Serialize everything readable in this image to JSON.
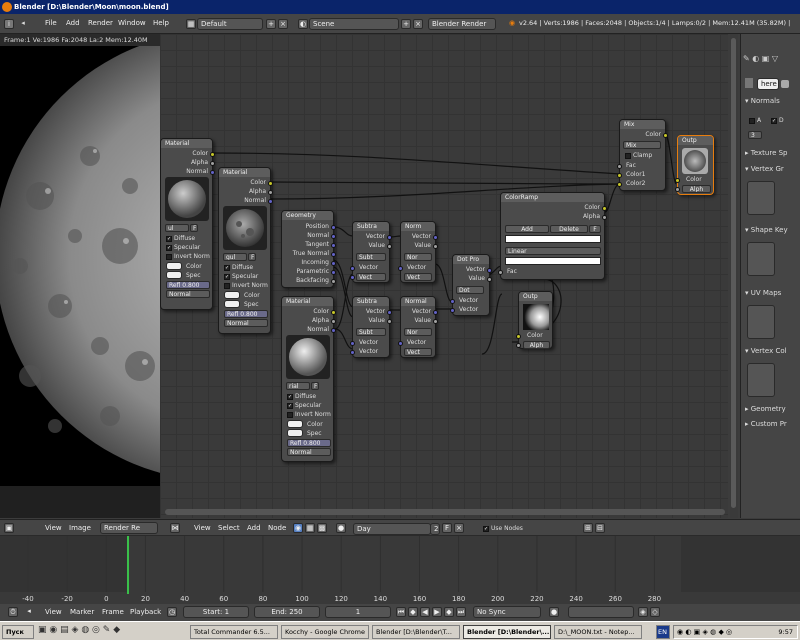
{
  "window_title": "Blender [D:\\Blender\\Moon\\moon.blend]",
  "menu": {
    "items": [
      "File",
      "Add",
      "Render",
      "Window",
      "Help"
    ]
  },
  "screen_layout": "Default",
  "scene_name": "Scene",
  "render_engine": "Blender Render",
  "stats": "v2.64 | Verts:1986 | Faces:2048 | Objects:1/4 | Lamps:0/2 | Mem:12.41M (35.82M) |",
  "image_view": {
    "info": "Frame:1 Ve:1986 Fa:2048 La:2 Mem:12.40M",
    "header": [
      "View",
      "Image",
      "Render Re"
    ]
  },
  "node_editor": {
    "header": [
      "View",
      "Select",
      "Add",
      "Node"
    ],
    "material_name": "Day",
    "users": "2",
    "fake_label": "F",
    "use_nodes": "Use Nodes",
    "nodes": {
      "mat1": {
        "title": "Material",
        "outputs": [
          "Color",
          "Alpha",
          "Normal"
        ],
        "mat_label": "ul",
        "f": "F",
        "checks": [
          "Diffuse",
          "Specular",
          "Invert Norm"
        ],
        "inputs": [
          "Color",
          "Spec"
        ],
        "refl": "Refl 0.800",
        "normal": "Normal"
      },
      "mat2": {
        "title": "Material",
        "outputs": [
          "Color",
          "Alpha",
          "Normal"
        ],
        "mat_label": "gul",
        "f": "F",
        "checks": [
          "Diffuse",
          "Specular",
          "Invert Norm"
        ],
        "inputs": [
          "Color",
          "Spec"
        ],
        "refl": "Refl 0.800",
        "normal": "Normal"
      },
      "geometry": {
        "title": "Geometry",
        "outputs": [
          "Position",
          "Normal",
          "Tangent",
          "True Normal",
          "Incoming",
          "Parametric",
          "Backfacing"
        ]
      },
      "mat3": {
        "title": "Material",
        "outputs": [
          "Color",
          "Alpha",
          "Normal"
        ],
        "mat_label": "rial",
        "f": "F",
        "checks": [
          "Diffuse",
          "Specular",
          "Invert Norm"
        ],
        "inputs": [
          "Color",
          "Spec"
        ],
        "refl": "Refl 0.800",
        "normal": "Normal"
      },
      "sub1": {
        "title": "Subtra",
        "outputs": [
          "Vector",
          "Value"
        ],
        "op": "Subt",
        "inputs": [
          "Vector",
          "Vect"
        ]
      },
      "sub2": {
        "title": "Subtra",
        "outputs": [
          "Vector",
          "Value"
        ],
        "op": "Subt",
        "inputs": [
          "Vector",
          "Vector"
        ]
      },
      "norm1": {
        "title": "Norm",
        "outputs": [
          "Vector",
          "Value"
        ],
        "op": "Nor",
        "inputs": [
          "Vector",
          "Vect"
        ]
      },
      "norm2": {
        "title": "Normal",
        "outputs": [
          "Vector",
          "Value"
        ],
        "op": "Nor",
        "inputs": [
          "Vector",
          "Vect"
        ]
      },
      "dot": {
        "title": "Dot Pro",
        "outputs": [
          "Vector",
          "Value"
        ],
        "op": "Dot",
        "inputs": [
          "Vector",
          "Vector"
        ]
      },
      "ramp": {
        "title": "ColorRamp",
        "outputs": [
          "Color",
          "Alpha"
        ],
        "add": "Add",
        "delete": "Delete",
        "f": "F",
        "interp": "Linear",
        "input": "Fac"
      },
      "out1": {
        "title": "Outp",
        "inputs": [
          "Color",
          "Alph"
        ]
      },
      "mix": {
        "title": "Mix",
        "outputs": [
          "Color"
        ],
        "blend": "Mix",
        "clamp": "Clamp",
        "inputs": [
          "Fac",
          "Color1",
          "Color2"
        ]
      },
      "out2": {
        "title": "Outp",
        "inputs": [
          "Color",
          "Alph"
        ]
      }
    }
  },
  "properties": {
    "tab": "here",
    "sections": [
      "Normals",
      "Texture Sp",
      "Vertex Gr",
      "Shape Key",
      "UV Maps",
      "Vertex Col",
      "Geometry",
      "Custom Pr"
    ],
    "normals_a": "A",
    "normals_d": "D",
    "normals_val": "3"
  },
  "timeline": {
    "ticks": [
      "-40",
      "-20",
      "0",
      "20",
      "40",
      "60",
      "80",
      "100",
      "120",
      "140",
      "160",
      "180",
      "200",
      "220",
      "240",
      "260",
      "280"
    ],
    "current_frame_pos": "1"
  },
  "playbar": {
    "menu": [
      "View",
      "Marker",
      "Frame",
      "Playback"
    ],
    "start": "Start: 1",
    "end": "End: 250",
    "current": "1",
    "sync": "No Sync"
  },
  "taskbar": {
    "start": "Пуск",
    "items": [
      "Total Commander 6.5...",
      "Kocchy - Google Chrome",
      "Blender [D:\\Blender\\T...",
      "Blender [D:\\Blender\\...",
      "D:\\_MOON.txt - Notep..."
    ],
    "lang": "EN",
    "clock": "9:57"
  },
  "colors": {
    "accent": "#e87d0d",
    "background": "#3a3a3a",
    "socket_color": "#c7c729",
    "socket_vector": "#6363c7",
    "socket_value": "#a1a1a1"
  }
}
